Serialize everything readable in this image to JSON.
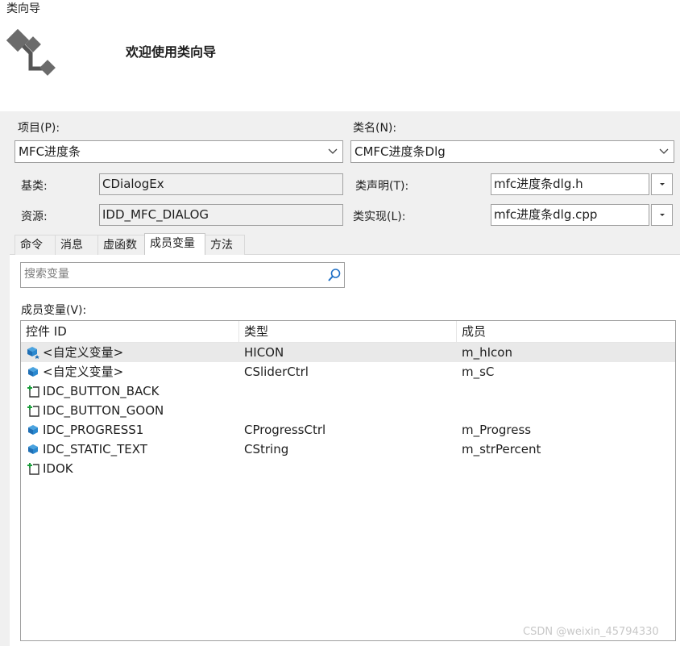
{
  "window": {
    "title": "类向导"
  },
  "header": {
    "welcome": "欢迎使用类向导",
    "logo_icon": "class-hierarchy-icon"
  },
  "project": {
    "label": "项目(P):",
    "value": "MFC进度条"
  },
  "classname": {
    "label": "类名(N):",
    "value": "CMFC进度条Dlg"
  },
  "base_class": {
    "label": "基类:",
    "value": "CDialogEx"
  },
  "resource": {
    "label": "资源:",
    "value": "IDD_MFC_DIALOG"
  },
  "class_decl": {
    "label": "类声明(T):",
    "value": "mfc进度条dlg.h"
  },
  "class_impl": {
    "label": "类实现(L):",
    "value": "mfc进度条dlg.cpp"
  },
  "tabs": [
    {
      "label": "命令",
      "active": false
    },
    {
      "label": "消息",
      "active": false
    },
    {
      "label": "虚函数",
      "active": false
    },
    {
      "label": "成员变量",
      "active": true
    },
    {
      "label": "方法",
      "active": false
    }
  ],
  "search": {
    "placeholder": "搜索变量",
    "value": ""
  },
  "member_vars": {
    "label": "成员变量(V):",
    "columns": [
      "控件 ID",
      "类型",
      "成员"
    ],
    "rows": [
      {
        "id": "<自定义变量>",
        "type": "HICON",
        "member": "m_hIcon",
        "icon": "custom-variable-star-icon",
        "selected": true
      },
      {
        "id": "<自定义变量>",
        "type": "CSliderCtrl",
        "member": "m_sC",
        "icon": "custom-variable-icon",
        "selected": false
      },
      {
        "id": "IDC_BUTTON_BACK",
        "type": "",
        "member": "",
        "icon": "control-add-icon",
        "selected": false
      },
      {
        "id": "IDC_BUTTON_GOON",
        "type": "",
        "member": "",
        "icon": "control-add-icon",
        "selected": false
      },
      {
        "id": "IDC_PROGRESS1",
        "type": "CProgressCtrl",
        "member": "m_Progress",
        "icon": "custom-variable-icon",
        "selected": false
      },
      {
        "id": "IDC_STATIC_TEXT",
        "type": "CString",
        "member": "m_strPercent",
        "icon": "custom-variable-icon",
        "selected": false
      },
      {
        "id": "IDOK",
        "type": "",
        "member": "",
        "icon": "control-add-icon",
        "selected": false
      }
    ]
  },
  "watermark": "CSDN @weixin_45794330"
}
